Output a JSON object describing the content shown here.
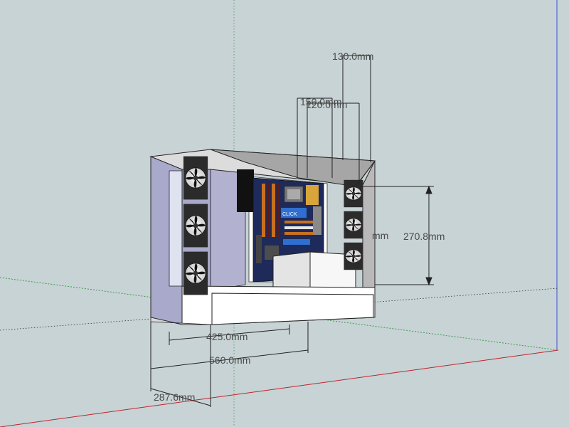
{
  "viewport": {
    "background": "#c8d3d5",
    "axis_colors": {
      "red": "#c0232b",
      "green": "#3d9c4a",
      "blue": "#3b4fd8",
      "inferred": "#333333"
    }
  },
  "dimensions": {
    "depth_upper": "130.0mm",
    "width_150": "150.0mm",
    "width_120": "120.0mm",
    "height_partial": "mm",
    "height": "270.8mm",
    "length_425": "425.0mm",
    "length_560": "560.0mm",
    "depth": "287.6mm"
  },
  "components": {
    "motherboard_label": "CLICK"
  }
}
